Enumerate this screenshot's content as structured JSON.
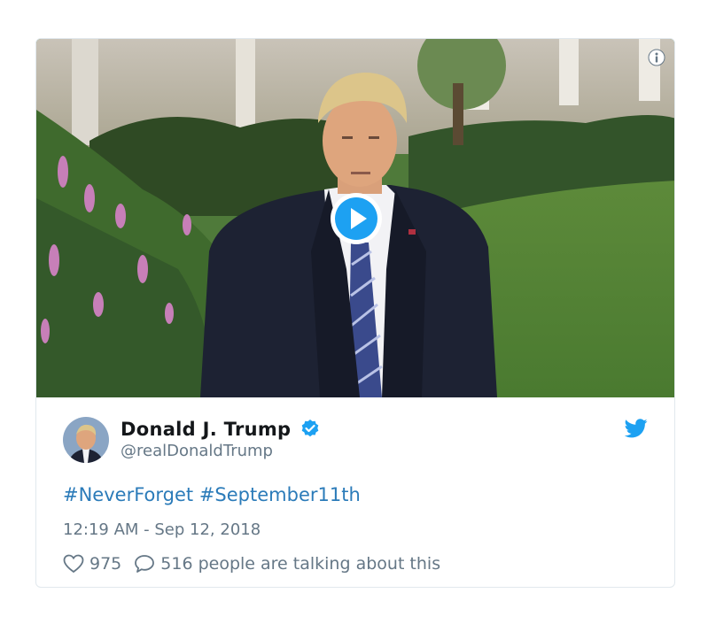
{
  "tweet": {
    "display_name": "Donald J. Trump",
    "handle": "@realDonaldTrump",
    "hashtags": [
      "#NeverForget",
      "#September11th"
    ],
    "timestamp": "12:19 AM - Sep 12, 2018",
    "likes": "975",
    "talking_text": "516 people are talking about this"
  },
  "icons": {
    "info": "info-icon",
    "play": "play-icon",
    "verified": "verified-badge-icon",
    "brand": "twitter-bird-icon",
    "like": "heart-icon",
    "reply": "speech-bubble-icon"
  },
  "colors": {
    "link": "#2b7bb9",
    "brand": "#1da1f2",
    "muted": "#657786",
    "text": "#14171a"
  }
}
